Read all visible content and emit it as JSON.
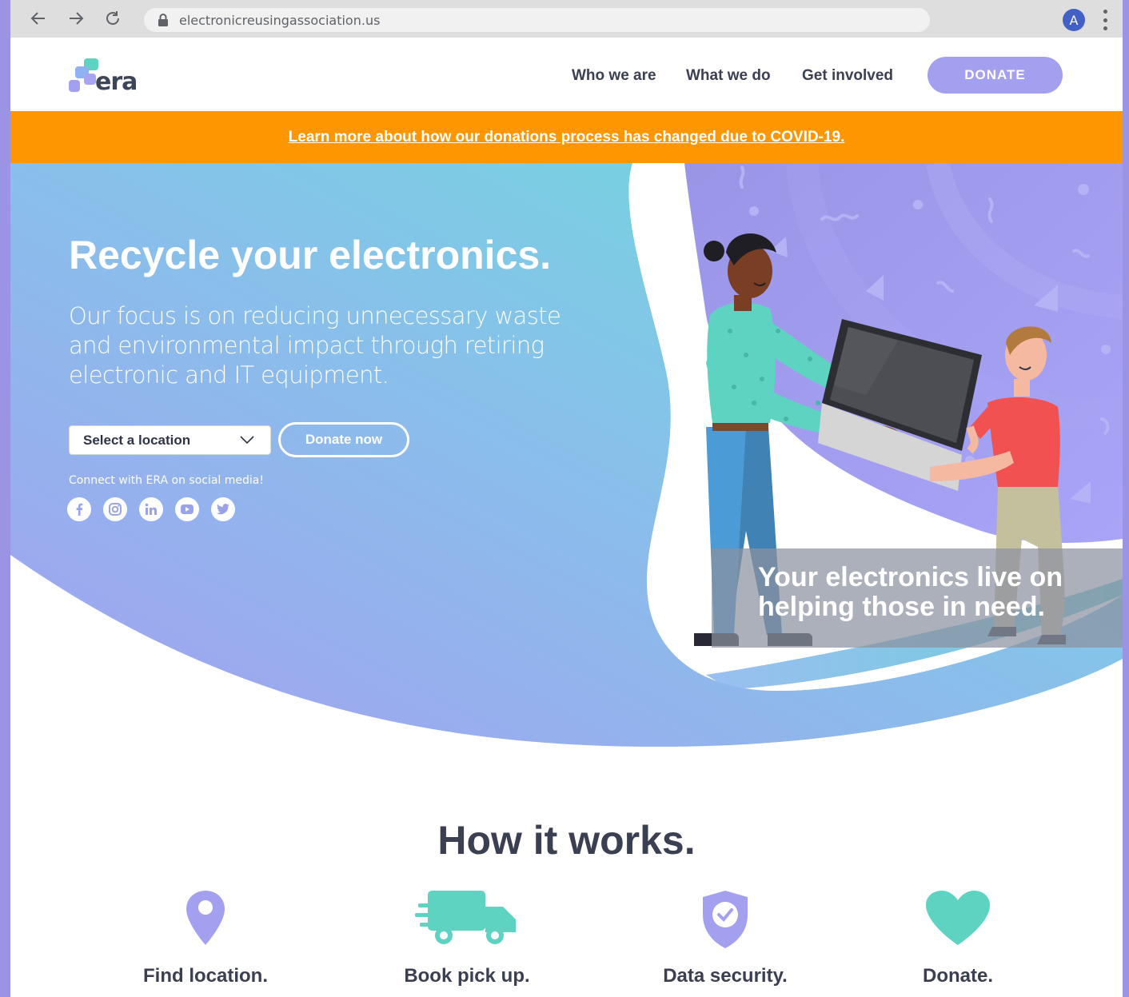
{
  "browser": {
    "url": "electronicreusingassociation.us",
    "profile_initial": "A"
  },
  "header": {
    "logo_text": "era",
    "nav": [
      "Who we are",
      "What we do",
      "Get involved"
    ],
    "donate_label": "DONATE"
  },
  "banner": {
    "text": "Learn more about how our donations process has changed due to COVID-19."
  },
  "hero": {
    "title": "Recycle your electronics.",
    "subtitle": "Our focus is on reducing unnecessary waste and environmental impact through retiring electronic and IT equipment.",
    "location_select": "Select a location",
    "donate_now": "Donate now",
    "social_label": "Connect with ERA on social media!",
    "social_icons": [
      "facebook-icon",
      "instagram-icon",
      "linkedin-icon",
      "youtube-icon",
      "twitter-icon"
    ],
    "caption": "Your electronics live on helping those in need."
  },
  "how": {
    "title": "How it works.",
    "steps": [
      {
        "label": "Find location.",
        "icon": "location-pin-icon"
      },
      {
        "label": "Book pick up.",
        "icon": "truck-icon"
      },
      {
        "label": "Data security.",
        "icon": "shield-check-icon"
      },
      {
        "label": "Donate.",
        "icon": "heart-icon"
      }
    ]
  },
  "colors": {
    "brand_purple": "#a4a0f0",
    "banner_orange": "#fd9600",
    "teal": "#5ed3c1",
    "text_dark": "#3a3f52"
  }
}
